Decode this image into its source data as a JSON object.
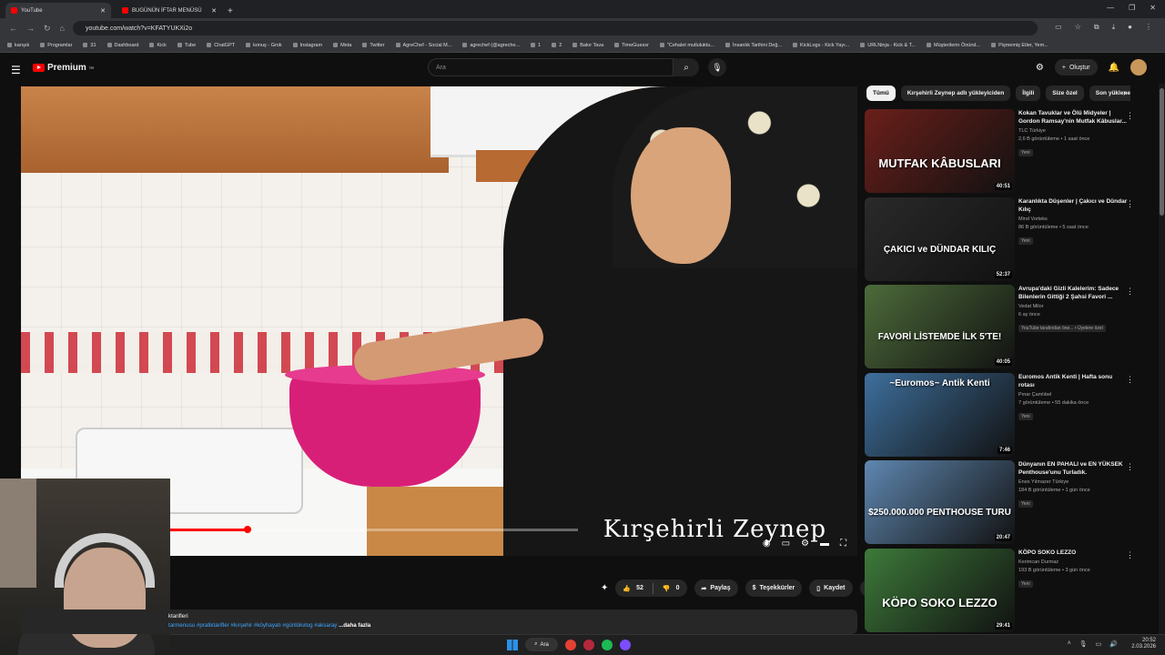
{
  "browser": {
    "tabs": [
      {
        "title": "YouTube",
        "active": true
      },
      {
        "title": "BUGÜNÜN İFTAR MENÜSÜ",
        "active": false
      }
    ],
    "url": "youtube.com/watch?v=KFATYUKXi2o",
    "bookmarks": [
      "karışık",
      "Programlar",
      "31",
      "Dashboard",
      "Kick",
      "Tube",
      "ChatGPT",
      "konuş - Grok",
      "Instagram",
      "Meta",
      "Twitter",
      "AgreChef - Social M...",
      "agrechef (@agreche...",
      "1",
      "2",
      "Bakır Tava",
      "TimeGuessr",
      "\"Cehalet mutluluktu...",
      "İnsanlık Tarihini Değ...",
      "KickLogs - Kick Yayı...",
      "URLNinja - Kick & T...",
      "Müşterilerin Önünd...",
      "Pişmemiş Etler, Yem..."
    ]
  },
  "header": {
    "logo_text": "Premium",
    "logo_sup": "TR",
    "search_placeholder": "Ara",
    "create_label": "Oluştur"
  },
  "player": {
    "watermark": "Kırşehirli Zeynep",
    "progress_fraction": 0.407
  },
  "actions": {
    "like_count": "52",
    "dislike_count": "0",
    "share_label": "Paylaş",
    "thanks_label": "Teşekkürler",
    "save_label": "Kaydet"
  },
  "description": {
    "line1": "ktarifleri",
    "tags": "tarmenusu #pratiktarifler #kırşehir #köyhayatı #günlükvlog #aksaray",
    "more": "...daha fazla"
  },
  "chips": [
    "Tümü",
    "Kırşehirli Zeynep adlı yükleyiciden",
    "İlgili",
    "Size özel",
    "Son yüklenenler"
  ],
  "recommendations": [
    {
      "title": "Kokan Tavuklar ve Ölü Midyeler | Gordon Ramsay'nin Mutfak Kâbuslar...",
      "channel": "TLC Türkiye",
      "stats": "2,6 B görüntüleme • 1 saat önce",
      "badge": "Yeni",
      "duration": "40:51",
      "thumb_text": "MUTFAK KÂBUSLARI",
      "thumb_color": "#6b1f1a"
    },
    {
      "title": "Karanlıkta Düşenler | Çakıcı ve Dündar Kılıç",
      "channel": "Mind Vorteks",
      "stats": "86 B görüntüleme • 5 saat önce",
      "badge": "Yeni",
      "duration": "52:37",
      "thumb_text": "ÇAKICI ve DÜNDAR KILIÇ",
      "thumb_color": "#2a2a2a"
    },
    {
      "title": "Avrupa'daki Gizli Kalelerim: Sadece Bilenlerin Gittiği 2 Şahsi Favori ...",
      "channel": "Vedat Milor",
      "stats": "6 ay önce",
      "badge": "YouTube tarafından öne... • Üyelere özel",
      "duration": "40:05",
      "thumb_text": "FAVORİ LİSTEMDE İLK 5'TE!",
      "thumb_color": "#4d6b3a"
    },
    {
      "title": "Euromos Antik Kenti | Hafta sonu rotası",
      "channel": "Pınar Çamlıbel",
      "stats": "7 görüntüleme • 55 dakika önce",
      "badge": "Yeni",
      "duration": "7:46",
      "thumb_text": "~Euromos~ Antik Kenti",
      "thumb_color": "#3e6f9c"
    },
    {
      "title": "Dünyanın EN PAHALI ve EN YÜKSEK Penthouse'unu Turladık.",
      "channel": "Enes Yılmazer Türkiye",
      "stats": "184 B görüntüleme • 1 gün önce",
      "badge": "Yeni",
      "duration": "20:47",
      "thumb_text": "$250.000.000 PENTHOUSE TURU",
      "thumb_color": "#5f87b0"
    },
    {
      "title": "KÖPO SOKO LEZZO",
      "channel": "Kerimcan Durmaz",
      "stats": "193 B görüntüleme • 3 gün önce",
      "badge": "Yeni",
      "duration": "29:41",
      "thumb_text": "KÖPO SOKO LEZZO",
      "thumb_color": "#3d7a3a"
    }
  ],
  "taskbar": {
    "search_label": "Ara",
    "time": "20:52",
    "date": "2.03.2026"
  }
}
